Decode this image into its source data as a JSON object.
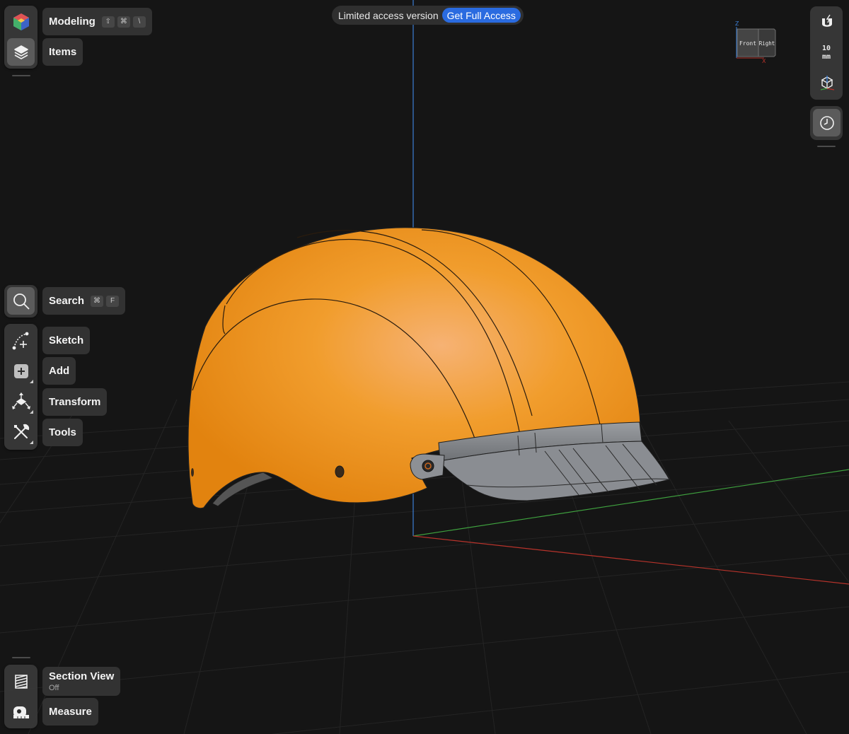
{
  "banner": {
    "text": "Limited access version",
    "button": "Get Full Access"
  },
  "workspace": {
    "label": "Modeling",
    "shortcut": [
      "⇧",
      "⌘",
      "\\"
    ]
  },
  "items": {
    "label": "Items"
  },
  "search": {
    "label": "Search",
    "shortcut": [
      "⌘",
      "F"
    ]
  },
  "tools": [
    {
      "label": "Sketch",
      "icon": "sketch-icon"
    },
    {
      "label": "Add",
      "icon": "add-icon"
    },
    {
      "label": "Transform",
      "icon": "transform-icon"
    },
    {
      "label": "Tools",
      "icon": "tools-icon"
    }
  ],
  "section_view": {
    "label": "Section View",
    "state": "Off"
  },
  "measure": {
    "label": "Measure"
  },
  "grid": {
    "value": "10",
    "unit": "mm"
  },
  "viewcube": {
    "front": "Front",
    "right": "Right",
    "z": "Z",
    "x": "X"
  },
  "colors": {
    "background": "#151515",
    "helmet": "#f0981c",
    "visor": "#8c8f94",
    "accent": "#2a6be0",
    "axis_x": "#b8332b",
    "axis_y": "#3fa23f",
    "axis_z": "#3b7fd6"
  }
}
